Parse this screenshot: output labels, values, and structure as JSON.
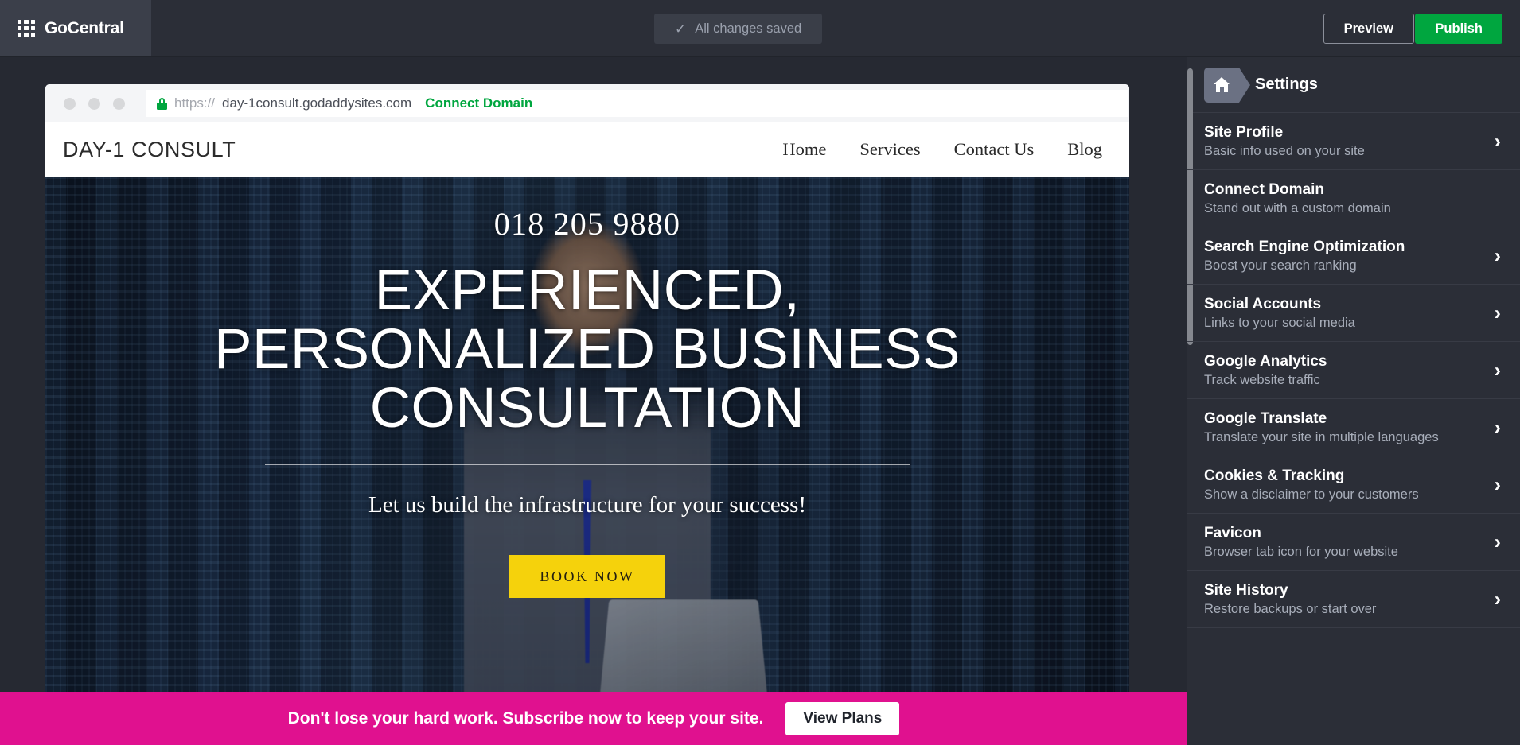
{
  "topbar": {
    "brand": "GoCentral",
    "grid_icon": "grid-icon",
    "save_status": "All changes saved",
    "save_check_icon": "check-icon",
    "preview_label": "Preview",
    "publish_label": "Publish",
    "publish_color": "#00a63f"
  },
  "browser": {
    "url_scheme": "https://",
    "url_host": "day-1consult.godaddysites.com",
    "connect_domain": "Connect Domain",
    "lock_icon": "lock-icon"
  },
  "site": {
    "logo": "DAY-1 CONSULT",
    "nav": [
      {
        "label": "Home"
      },
      {
        "label": "Services"
      },
      {
        "label": "Contact Us"
      },
      {
        "label": "Blog"
      }
    ],
    "hero": {
      "phone": "018 205 9880",
      "headline_line1": "EXPERIENCED,",
      "headline_line2": "PERSONALIZED BUSINESS",
      "headline_line3": "CONSULTATION",
      "tagline": "Let us build the infrastructure for your success!",
      "cta_label": "BOOK NOW",
      "cta_color": "#f5d20c"
    }
  },
  "promo": {
    "message": "Don't lose your hard work. Subscribe now to keep your site.",
    "button_label": "View Plans",
    "background_color": "#e0118f"
  },
  "sidebar": {
    "home_icon": "home-icon",
    "title": "Settings",
    "items": [
      {
        "label": "Site Profile",
        "sub": "Basic info used on your site",
        "chevron": "›"
      },
      {
        "label": "Connect Domain",
        "sub": "Stand out with a custom domain",
        "chevron": ""
      },
      {
        "label": "Search Engine Optimization",
        "sub": "Boost your search ranking",
        "chevron": "›"
      },
      {
        "label": "Social Accounts",
        "sub": "Links to your social media",
        "chevron": "›"
      },
      {
        "label": "Google Analytics",
        "sub": "Track website traffic",
        "chevron": "›"
      },
      {
        "label": "Google Translate",
        "sub": "Translate your site in multiple languages",
        "chevron": "›"
      },
      {
        "label": "Cookies & Tracking",
        "sub": "Show a disclaimer to your customers",
        "chevron": "›"
      },
      {
        "label": "Favicon",
        "sub": "Browser tab icon for your website",
        "chevron": "›"
      },
      {
        "label": "Site History",
        "sub": "Restore backups or start over",
        "chevron": "›"
      }
    ]
  }
}
